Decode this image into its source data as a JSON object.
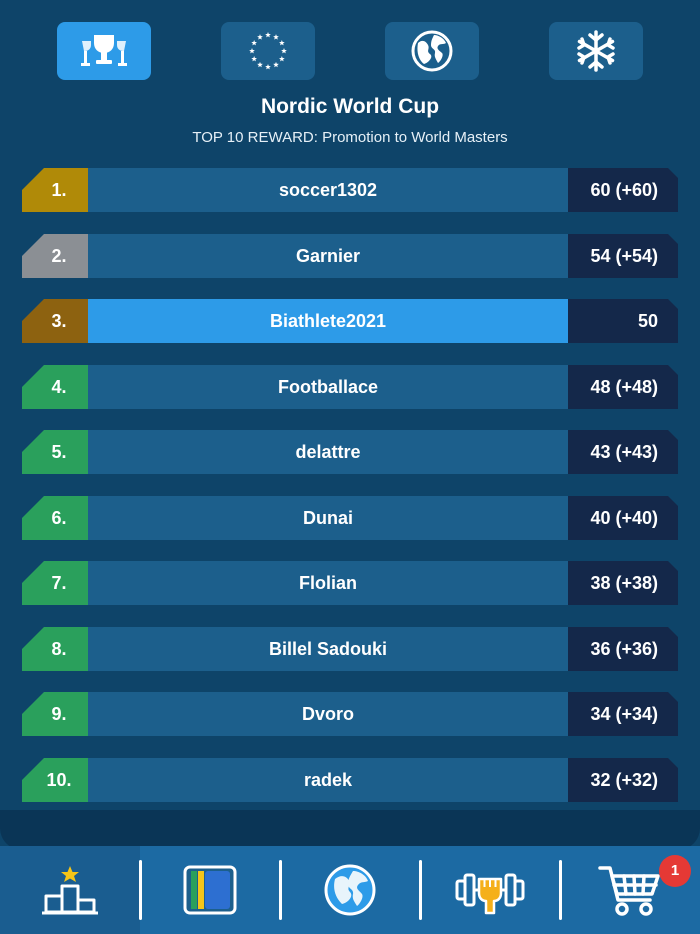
{
  "tabs": [
    {
      "icon": "trophy-icon",
      "active": true
    },
    {
      "icon": "europe-stars-icon",
      "active": false
    },
    {
      "icon": "globe-icon",
      "active": false
    },
    {
      "icon": "snowflake-icon",
      "active": false
    }
  ],
  "header": {
    "title": "Nordic World Cup",
    "subtitle": "TOP 10 REWARD: Promotion to World Masters"
  },
  "leaderboard": [
    {
      "rank": "1.",
      "name": "soccer1302",
      "score": "60 (+60)"
    },
    {
      "rank": "2.",
      "name": "Garnier",
      "score": "54 (+54)"
    },
    {
      "rank": "3.",
      "name": "Biathlete2021",
      "score": "50"
    },
    {
      "rank": "4.",
      "name": "Footballace",
      "score": "48 (+48)"
    },
    {
      "rank": "5.",
      "name": "delattre",
      "score": "43 (+43)"
    },
    {
      "rank": "6.",
      "name": "Dunai",
      "score": "40 (+40)"
    },
    {
      "rank": "7.",
      "name": "Flolian",
      "score": "38 (+38)"
    },
    {
      "rank": "8.",
      "name": "Billel Sadouki",
      "score": "36 (+36)"
    },
    {
      "rank": "9.",
      "name": "Dvoro",
      "score": "34 (+34)"
    },
    {
      "rank": "10.",
      "name": "radek",
      "score": "32 (+32)"
    }
  ],
  "nav": [
    {
      "icon": "podium-icon"
    },
    {
      "icon": "cards-icon"
    },
    {
      "icon": "world-icon"
    },
    {
      "icon": "training-icon"
    },
    {
      "icon": "shop-cart-icon"
    }
  ],
  "cart_badge": "1",
  "colors": {
    "background": "#0e4469",
    "row": "#1c5f8c",
    "highlight": "#2d9be8",
    "score_bg": "#14284a",
    "gold": "#b08a08",
    "silver": "#8b8f94",
    "bronze": "#8d6210",
    "green": "#2aa05c",
    "badge": "#e53935"
  }
}
